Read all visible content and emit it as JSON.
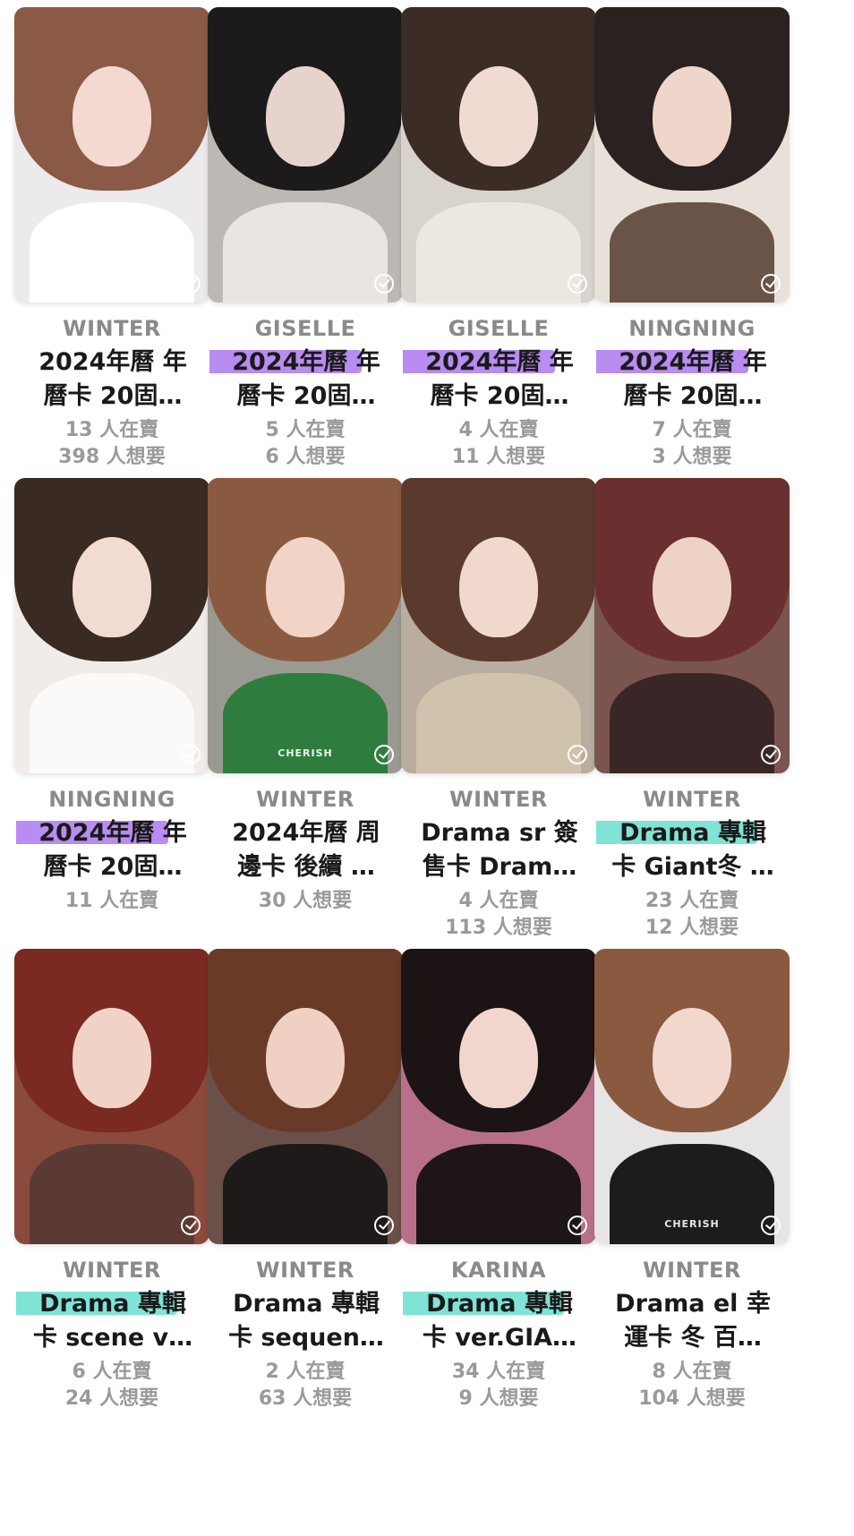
{
  "colors": {
    "highlight_purple": "#b88cf0",
    "highlight_teal": "#7fe3d6",
    "member_text": "#8a8a8a",
    "title_text": "#1a1a1a",
    "stats_text": "#9a9a9a"
  },
  "icons": {
    "card_check": "check-circle-icon"
  },
  "cards": [
    {
      "member": "WINTER",
      "title_line1": "2024年曆 年",
      "title_line2": "曆卡 20固…",
      "stat_sell": "13 人在賣",
      "stat_want": "398 人想要",
      "highlight": "",
      "watermark": "",
      "palette": {
        "bg": "#eceaec",
        "hair": "#8a5a46",
        "face": "#f3d9cf",
        "body": "#ffffff"
      }
    },
    {
      "member": "GISELLE",
      "title_line1": "2024年曆 年",
      "title_line2": "曆卡 20固…",
      "stat_sell": "5 人在賣",
      "stat_want": "6 人想要",
      "highlight": "purple",
      "watermark": "",
      "palette": {
        "bg": "#bdb8b4",
        "hair": "#1c1a1a",
        "face": "#e6d3cb",
        "body": "#e9e6e2"
      }
    },
    {
      "member": "GISELLE",
      "title_line1": "2024年曆 年",
      "title_line2": "曆卡 20固…",
      "stat_sell": "4 人在賣",
      "stat_want": "11 人想要",
      "highlight": "purple",
      "watermark": "",
      "palette": {
        "bg": "#d9d3cd",
        "hair": "#3c2c26",
        "face": "#f0dbd2",
        "body": "#ece8e1"
      }
    },
    {
      "member": "NINGNING",
      "title_line1": "2024年曆 年",
      "title_line2": "曆卡 20固…",
      "stat_sell": "7 人在賣",
      "stat_want": "3 人想要",
      "highlight": "purple",
      "watermark": "",
      "palette": {
        "bg": "#e7e1d9",
        "hair": "#2a2220",
        "face": "#efd6ca",
        "body": "#6a5448"
      }
    },
    {
      "member": "NINGNING",
      "title_line1": "2024年曆 年",
      "title_line2": "曆卡 20固…",
      "stat_sell": "11 人在賣",
      "stat_want": "",
      "highlight": "purple",
      "watermark": "",
      "palette": {
        "bg": "#f1ece7",
        "hair": "#3a2a24",
        "face": "#f2dcd2",
        "body": "#fbfaf8"
      }
    },
    {
      "member": "WINTER",
      "title_line1": "2024年曆 周",
      "title_line2": "邊卡 後續 …",
      "stat_sell": "30 人想要",
      "stat_want": "",
      "highlight": "",
      "watermark": "CHERISH",
      "palette": {
        "bg": "#9a9a92",
        "hair": "#8a5a40",
        "face": "#f1d4c6",
        "body": "#2e7d3e"
      }
    },
    {
      "member": "WINTER",
      "title_line1": "Drama sr 簽",
      "title_line2": "售卡 Dram…",
      "stat_sell": "4 人在賣",
      "stat_want": "113 人想要",
      "highlight": "",
      "watermark": "",
      "palette": {
        "bg": "#b9ada0",
        "hair": "#5a3a2c",
        "face": "#f1d8cc",
        "body": "#cfc3ad"
      }
    },
    {
      "member": "WINTER",
      "title_line1": "Drama 專輯",
      "title_line2": "卡 Giant冬 …",
      "stat_sell": "23 人在賣",
      "stat_want": "12 人想要",
      "highlight": "teal",
      "watermark": "",
      "palette": {
        "bg": "#7a5550",
        "hair": "#6a3030",
        "face": "#efd2c6",
        "body": "#3a2626"
      }
    },
    {
      "member": "WINTER",
      "title_line1": "Drama 專輯",
      "title_line2": "卡 scene v…",
      "stat_sell": "6 人在賣",
      "stat_want": "24 人想要",
      "highlight": "teal",
      "watermark": "",
      "palette": {
        "bg": "#8a4a3e",
        "hair": "#7a2a22",
        "face": "#f0d3c6",
        "body": "#5a3a32"
      }
    },
    {
      "member": "WINTER",
      "title_line1": "Drama 專輯",
      "title_line2": "卡 sequen…",
      "stat_sell": "2 人在賣",
      "stat_want": "63 人想要",
      "highlight": "",
      "watermark": "",
      "palette": {
        "bg": "#6a5048",
        "hair": "#6a3a28",
        "face": "#f0d0c2",
        "body": "#1e1a1a"
      }
    },
    {
      "member": "KARINA",
      "title_line1": "Drama 專輯",
      "title_line2": "卡 ver.GIA…",
      "stat_sell": "34 人在賣",
      "stat_want": "9 人想要",
      "highlight": "teal",
      "watermark": "",
      "palette": {
        "bg": "#b8708a",
        "hair": "#1c1414",
        "face": "#f0d6cc",
        "body": "#1e1616"
      }
    },
    {
      "member": "WINTER",
      "title_line1": "Drama el 幸",
      "title_line2": "運卡 冬 百…",
      "stat_sell": "8 人在賣",
      "stat_want": "104 人想要",
      "highlight": "",
      "watermark": "CHERISH",
      "palette": {
        "bg": "#e6e4e4",
        "hair": "#8a5a40",
        "face": "#f2d8cc",
        "body": "#1c1c1e"
      }
    }
  ]
}
